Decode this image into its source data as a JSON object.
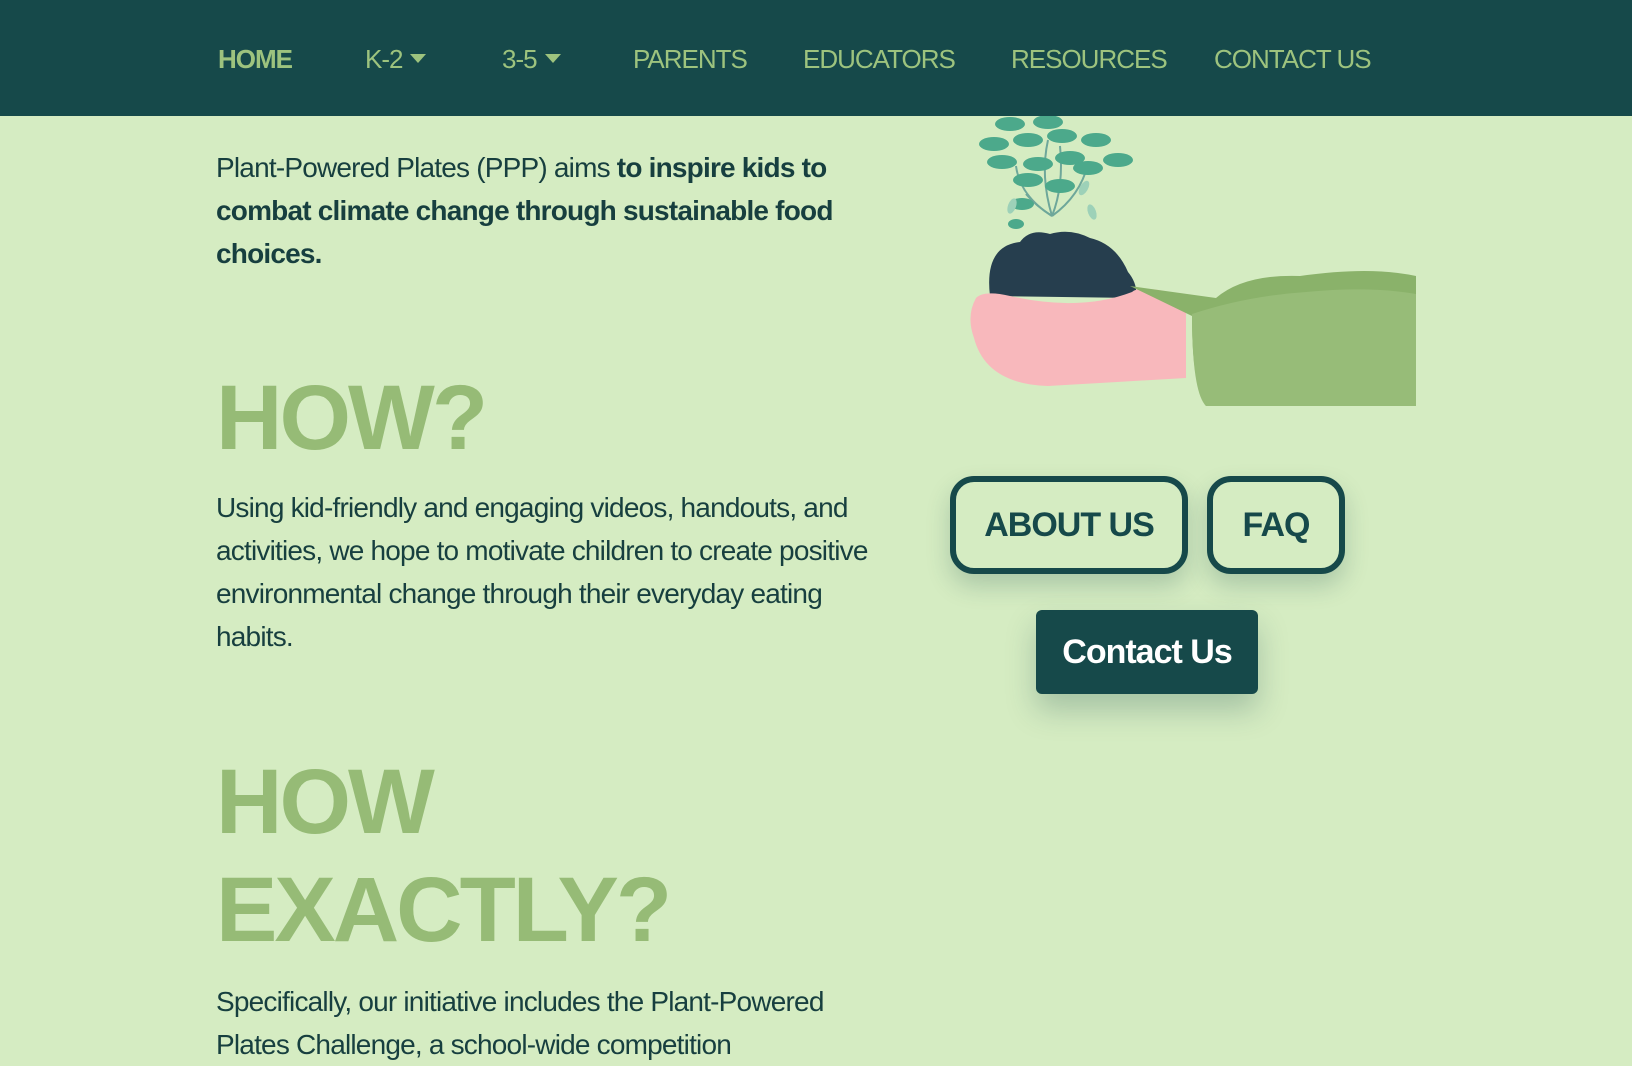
{
  "nav": {
    "home": "HOME",
    "k2": "K-2",
    "g35": "3-5",
    "parents": "PARENTS",
    "educators": "EDUCATORS",
    "resources": "RESOURCES",
    "contact": "CONTACT US"
  },
  "intro": {
    "lead": "Plant-Powered Plates (PPP) aims ",
    "bold": "to inspire kids to combat climate change through sustainable food choices."
  },
  "how": {
    "heading": "HOW?",
    "text": "Using kid-friendly and engaging videos, handouts, and activities, we hope to motivate children to create positive environmental change through their everyday eating habits."
  },
  "how_exactly": {
    "heading_line1": "HOW",
    "heading_line2": "EXACTLY?",
    "text": "Specifically, our initiative includes the Plant-Powered Plates Challenge, a school-wide competition"
  },
  "buttons": {
    "about": "ABOUT US",
    "faq": "FAQ",
    "contact": "Contact Us"
  },
  "colors": {
    "nav_bg": "#16494a",
    "page_bg": "#d5ecc2",
    "accent_green": "#96bb76",
    "text_dark": "#173f3f"
  }
}
